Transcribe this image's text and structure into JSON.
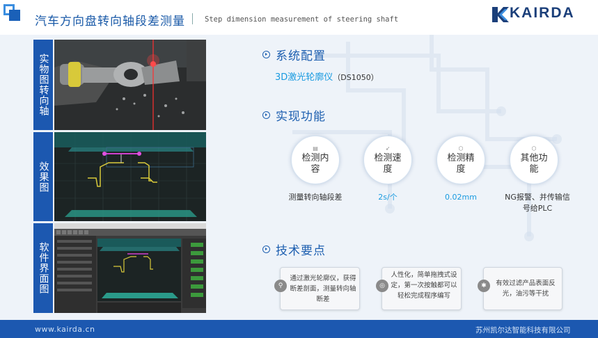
{
  "header": {
    "title": "汽车方向盘转向轴段差测量",
    "subtitle": "Step dimension measurement of steering shaft",
    "logo": "KAIRDA"
  },
  "sidebar": {
    "labels": [
      "实物图转向轴",
      "效果图",
      "软件界面图"
    ]
  },
  "system": {
    "heading": "系统配置",
    "device_name": "3D激光轮廓仪",
    "device_model": "（DS1050）"
  },
  "functions": {
    "heading": "实现功能",
    "items": [
      {
        "label": "检测内容",
        "value": "测量转向轴段差",
        "value_color": "#333333",
        "icon": "document-icon"
      },
      {
        "label": "检测速度",
        "value": "2s/个",
        "value_color": "#1a9be0",
        "icon": "rocket-icon"
      },
      {
        "label": "检测精度",
        "value": "0.02mm",
        "value_color": "#1a9be0",
        "icon": "cube-icon"
      },
      {
        "label": "其他功能",
        "value": "NG报警、并传输信号给PLC",
        "value_color": "#333333",
        "icon": "box-icon"
      }
    ]
  },
  "tech": {
    "heading": "技术要点",
    "cards": [
      {
        "text": "通过激光轮廓仪，获得断差剖面，测量转向轴断差",
        "icon": "search-icon"
      },
      {
        "text": "人性化，简单拖拽式设定，第一次按触都可以轻松完成程序编写",
        "icon": "compass-icon"
      },
      {
        "text": "有效过滤产品表面反光，油污等干扰",
        "icon": "gear-icon"
      }
    ]
  },
  "footer": {
    "url": "www.kairda.cn",
    "company": "苏州凯尔达智能科技有限公司"
  },
  "colors": {
    "brand_blue": "#1c58b0",
    "accent_cyan": "#1a9be0"
  }
}
